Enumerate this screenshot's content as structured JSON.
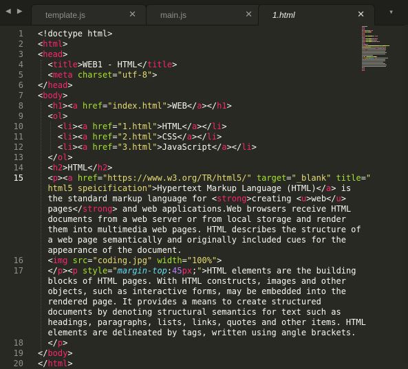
{
  "tabs": [
    {
      "label": "template.js",
      "close": "✕",
      "active": false
    },
    {
      "label": "main.js",
      "close": "✕",
      "active": false
    },
    {
      "label": "1.html",
      "close": "✕",
      "active": true
    }
  ],
  "nav": {
    "back_icon": "◀",
    "forward_icon": "▶"
  },
  "tab_overflow_icon": "▾",
  "line_numbers": [
    "1",
    "2",
    "3",
    "4",
    "5",
    "6",
    "7",
    "8",
    "9",
    "10",
    "11",
    "12",
    "13",
    "14",
    "15",
    "16",
    "17",
    "18",
    "19",
    "20"
  ],
  "current_line": "15",
  "code_lines": [
    [
      [
        "tx",
        "<!doctype html>"
      ]
    ],
    [
      [
        "tx",
        "<"
      ],
      [
        "tg",
        "html"
      ],
      [
        "tx",
        ">"
      ]
    ],
    [
      [
        "tx",
        "<"
      ],
      [
        "tg",
        "head"
      ],
      [
        "tx",
        ">"
      ]
    ],
    [
      [
        "tx",
        "  <"
      ],
      [
        "tg",
        "title"
      ],
      [
        "tx",
        ">WEB1 - HTML</"
      ],
      [
        "tg",
        "title"
      ],
      [
        "tx",
        ">"
      ]
    ],
    [
      [
        "tx",
        "  <"
      ],
      [
        "tg",
        "meta"
      ],
      [
        "at",
        " charset"
      ],
      [
        "tx",
        "="
      ],
      [
        "st",
        "\"utf-8\""
      ],
      [
        "tx",
        ">"
      ]
    ],
    [
      [
        "tx",
        "</"
      ],
      [
        "tg",
        "head"
      ],
      [
        "tx",
        ">"
      ]
    ],
    [
      [
        "tx",
        "<"
      ],
      [
        "tg",
        "body"
      ],
      [
        "tx",
        ">"
      ]
    ],
    [
      [
        "tx",
        "  <"
      ],
      [
        "tg",
        "h1"
      ],
      [
        "tx",
        "><"
      ],
      [
        "tg",
        "a"
      ],
      [
        "at",
        " href"
      ],
      [
        "tx",
        "="
      ],
      [
        "st",
        "\"index.html\""
      ],
      [
        "tx",
        ">WEB</"
      ],
      [
        "tg",
        "a"
      ],
      [
        "tx",
        "></"
      ],
      [
        "tg",
        "h1"
      ],
      [
        "tx",
        ">"
      ]
    ],
    [
      [
        "tx",
        "  <"
      ],
      [
        "tg",
        "ol"
      ],
      [
        "tx",
        ">"
      ]
    ],
    [
      [
        "tx",
        "    <"
      ],
      [
        "tg",
        "li"
      ],
      [
        "tx",
        "><"
      ],
      [
        "tg",
        "a"
      ],
      [
        "at",
        " href"
      ],
      [
        "tx",
        "="
      ],
      [
        "st",
        "\"1.html\""
      ],
      [
        "tx",
        ">HTML</"
      ],
      [
        "tg",
        "a"
      ],
      [
        "tx",
        "></"
      ],
      [
        "tg",
        "li"
      ],
      [
        "tx",
        ">"
      ]
    ],
    [
      [
        "tx",
        "    <"
      ],
      [
        "tg",
        "li"
      ],
      [
        "tx",
        "><"
      ],
      [
        "tg",
        "a"
      ],
      [
        "at",
        " href"
      ],
      [
        "tx",
        "="
      ],
      [
        "st",
        "\"2.html\""
      ],
      [
        "tx",
        ">CSS</"
      ],
      [
        "tg",
        "a"
      ],
      [
        "tx",
        "></"
      ],
      [
        "tg",
        "li"
      ],
      [
        "tx",
        ">"
      ]
    ],
    [
      [
        "tx",
        "    <"
      ],
      [
        "tg",
        "li"
      ],
      [
        "tx",
        "><"
      ],
      [
        "tg",
        "a"
      ],
      [
        "at",
        " href"
      ],
      [
        "tx",
        "="
      ],
      [
        "st",
        "\"3.html\""
      ],
      [
        "tx",
        ">JavaScript</"
      ],
      [
        "tg",
        "a"
      ],
      [
        "tx",
        "></"
      ],
      [
        "tg",
        "li"
      ],
      [
        "tx",
        ">"
      ]
    ],
    [
      [
        "tx",
        "  </"
      ],
      [
        "tg",
        "ol"
      ],
      [
        "tx",
        ">"
      ]
    ],
    [
      [
        "tx",
        "  <"
      ],
      [
        "tg",
        "h2"
      ],
      [
        "tx",
        ">HTML</"
      ],
      [
        "tg",
        "h2"
      ],
      [
        "tx",
        ">"
      ]
    ],
    [
      [
        "tx",
        "  <"
      ],
      [
        "tg",
        "p"
      ],
      [
        "tx",
        "><"
      ],
      [
        "tg",
        "a"
      ],
      [
        "at",
        " href"
      ],
      [
        "tx",
        "="
      ],
      [
        "st",
        "\"https://www.w3.org/TR/html5/\""
      ],
      [
        "at",
        " target"
      ],
      [
        "tx",
        "="
      ],
      [
        "st",
        "\"_blank\""
      ],
      [
        "at",
        " title"
      ],
      [
        "tx",
        "="
      ],
      [
        "st",
        "\""
      ]
    ],
    [
      [
        "st",
        "  html5 speicification\""
      ],
      [
        "tx",
        ">Hypertext Markup Language (HTML)</"
      ],
      [
        "tg",
        "a"
      ],
      [
        "tx",
        "> is"
      ]
    ],
    [
      [
        "tx",
        "  the standard markup language for <"
      ],
      [
        "tg",
        "strong"
      ],
      [
        "tx",
        ">creating <"
      ],
      [
        "tg",
        "u"
      ],
      [
        "tx",
        ">web</"
      ],
      [
        "tg",
        "u"
      ],
      [
        "tx",
        ">"
      ]
    ],
    [
      [
        "tx",
        "  pages</"
      ],
      [
        "tg",
        "strong"
      ],
      [
        "tx",
        "> and web applications.Web browsers receive HTML"
      ]
    ],
    [
      [
        "tx",
        "  documents from a web server or from local storage and render"
      ]
    ],
    [
      [
        "tx",
        "  them into multimedia web pages. HTML describes the structure of"
      ]
    ],
    [
      [
        "tx",
        "  a web page semantically and originally included cues for the"
      ]
    ],
    [
      [
        "tx",
        "  appearance of the document."
      ]
    ],
    [
      [
        "tx",
        "  <"
      ],
      [
        "tg",
        "img"
      ],
      [
        "at",
        " src"
      ],
      [
        "tx",
        "="
      ],
      [
        "st",
        "\"coding.jpg\""
      ],
      [
        "at",
        " width"
      ],
      [
        "tx",
        "="
      ],
      [
        "st",
        "\"100%\""
      ],
      [
        "tx",
        ">"
      ]
    ],
    [
      [
        "tx",
        "  </"
      ],
      [
        "tg",
        "p"
      ],
      [
        "tx",
        "><"
      ],
      [
        "tg",
        "p"
      ],
      [
        "at",
        " style"
      ],
      [
        "tx",
        "="
      ],
      [
        "st",
        "\""
      ],
      [
        "ps",
        "margin-top"
      ],
      [
        "tx",
        ":"
      ],
      [
        "nu",
        "45"
      ],
      [
        "tg",
        "px"
      ],
      [
        "tx",
        ";"
      ],
      [
        "st",
        "\""
      ],
      [
        "tx",
        ">HTML elements are the building"
      ]
    ],
    [
      [
        "tx",
        "  blocks of HTML pages. With HTML constructs, images and other"
      ]
    ],
    [
      [
        "tx",
        "  objects, such as interactive forms, may be embedded into the"
      ]
    ],
    [
      [
        "tx",
        "  rendered page. It provides a means to create structured"
      ]
    ],
    [
      [
        "tx",
        "  documents by denoting structural semantics for text such as"
      ]
    ],
    [
      [
        "tx",
        "  headings, paragraphs, lists, links, quotes and other items. HTML"
      ]
    ],
    [
      [
        "tx",
        "  elements are delineated by tags, written using angle brackets."
      ]
    ],
    [
      [
        "tx",
        "  </"
      ],
      [
        "tg",
        "p"
      ],
      [
        "tx",
        ">"
      ]
    ],
    [
      [
        "tx",
        "</"
      ],
      [
        "tg",
        "body"
      ],
      [
        "tx",
        ">"
      ]
    ],
    [
      [
        "tx",
        "</"
      ],
      [
        "tg",
        "html"
      ],
      [
        "tx",
        ">"
      ]
    ]
  ],
  "colors": {
    "background": "#282923",
    "tag": "#f92672",
    "attribute": "#a6e22e",
    "string": "#e6db74",
    "property": "#66d9ef",
    "number": "#ae81ff",
    "text": "#f8f8f2"
  }
}
